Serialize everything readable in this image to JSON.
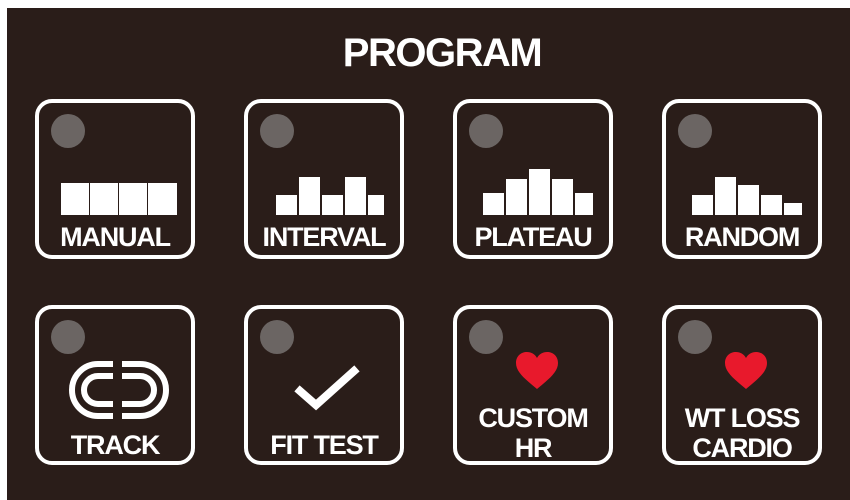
{
  "panel": {
    "title": "PROGRAM",
    "background": "#2a1d19",
    "led_color": "#6b6563",
    "heart_color": "#e8192c"
  },
  "programs": [
    {
      "id": "manual",
      "label": "MANUAL",
      "icon": "bar-profile-icon"
    },
    {
      "id": "interval",
      "label": "INTERVAL",
      "icon": "bar-profile-icon"
    },
    {
      "id": "plateau",
      "label": "PLATEAU",
      "icon": "bar-profile-icon"
    },
    {
      "id": "random",
      "label": "RANDOM",
      "icon": "bar-profile-icon"
    },
    {
      "id": "track",
      "label": "TRACK",
      "icon": "track-icon"
    },
    {
      "id": "fit-test",
      "label": "FIT TEST",
      "icon": "checkmark-icon"
    },
    {
      "id": "custom-hr",
      "label_line1": "CUSTOM",
      "label_line2": "HR",
      "icon": "heart-icon"
    },
    {
      "id": "wt-loss-cardio",
      "label_line1": "WT LOSS",
      "label_line2": "CARDIO",
      "icon": "heart-icon"
    }
  ]
}
